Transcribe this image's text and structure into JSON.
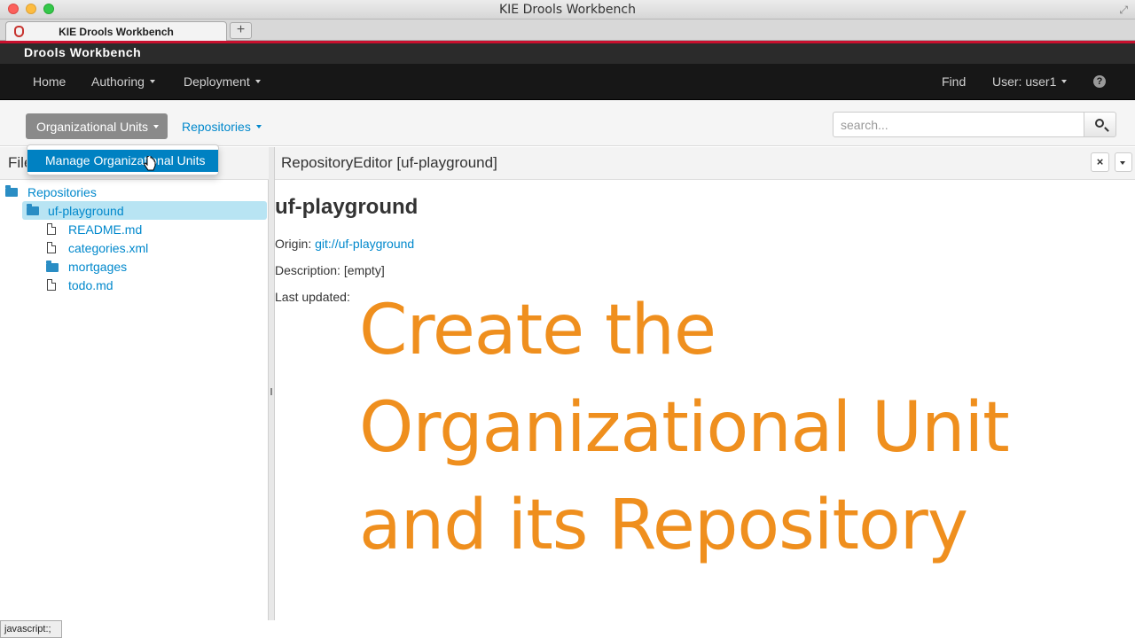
{
  "window": {
    "title": "KIE Drools Workbench",
    "tab_label": "KIE Drools Workbench",
    "new_tab_label": "+"
  },
  "app": {
    "brand": "Drools Workbench",
    "accent_color": "#c8102e",
    "link_color": "#0088cc",
    "nav": {
      "home": "Home",
      "authoring": "Authoring",
      "deployment": "Deployment",
      "find": "Find",
      "user": "User: user1",
      "help_icon": "question-circle-icon"
    }
  },
  "toolbar": {
    "org_units_label": "Organizational Units",
    "repositories_label": "Repositories",
    "search_placeholder": "search...",
    "search_icon": "search-icon"
  },
  "dropdown": {
    "items": [
      "Manage Organizational Units"
    ]
  },
  "left_panel": {
    "title": "Files",
    "tree": [
      {
        "label": "Repositories",
        "type": "folder",
        "level": 0
      },
      {
        "label": "uf-playground",
        "type": "folder",
        "level": 1,
        "selected": true
      },
      {
        "label": "README.md",
        "type": "file",
        "level": 2
      },
      {
        "label": "categories.xml",
        "type": "file",
        "level": 2
      },
      {
        "label": "mortgages",
        "type": "folder",
        "level": 2
      },
      {
        "label": "todo.md",
        "type": "file",
        "level": 2
      }
    ]
  },
  "editor": {
    "title": "RepositoryEditor [uf-playground]",
    "close_label": "×",
    "repo_name": "uf-playground",
    "origin_label": "Origin:",
    "origin_value": "git://uf-playground",
    "description_label": "Description:",
    "description_value": "[empty]",
    "last_updated_label": "Last updated:"
  },
  "overlay": {
    "line1": "Create the",
    "line2": "Organizational Unit",
    "line3": "and its Repository",
    "color": "#ef8f1e"
  },
  "statusbar": {
    "text": "javascript:;"
  }
}
